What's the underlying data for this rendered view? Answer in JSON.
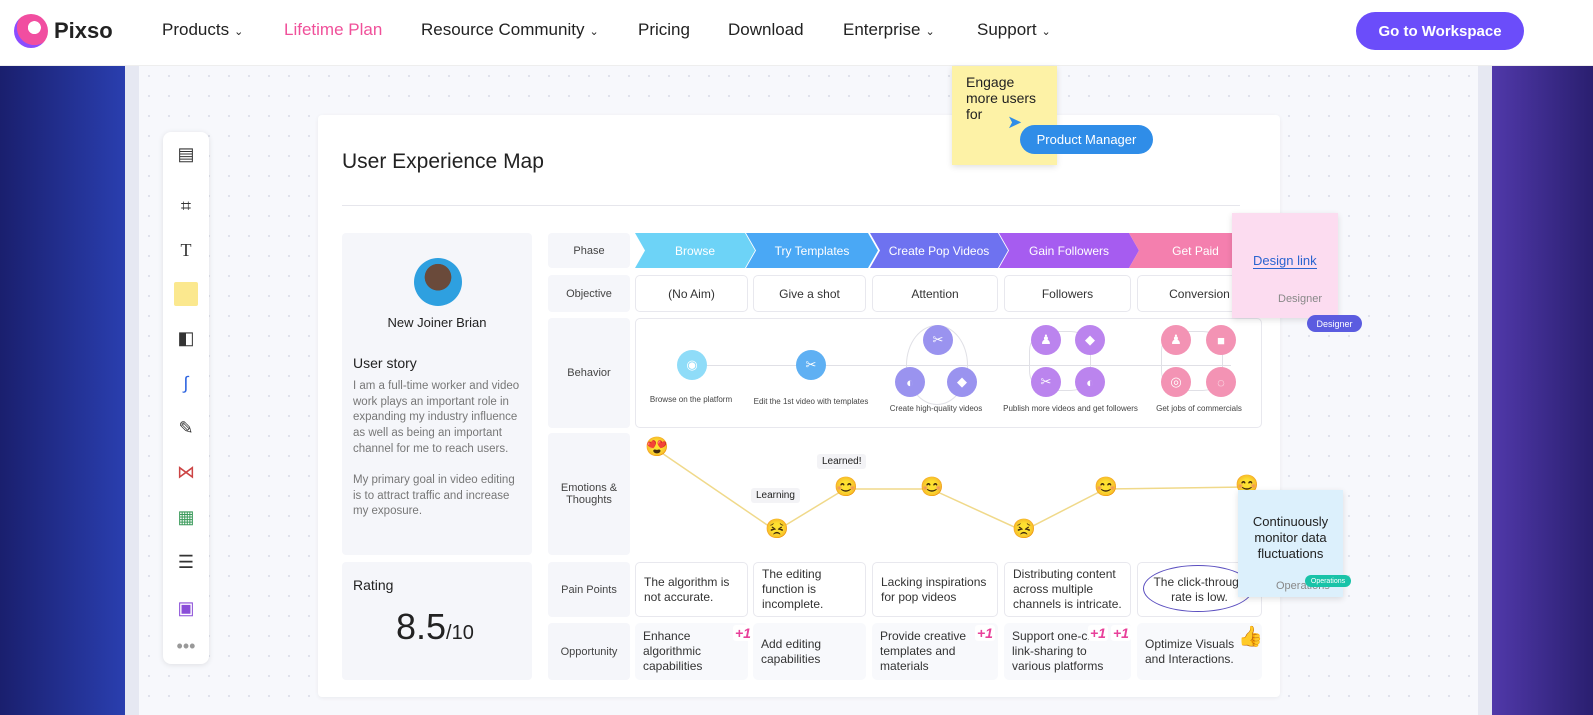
{
  "nav": {
    "brand": "Pixso",
    "items": [
      {
        "label": "Products",
        "dropdown": true
      },
      {
        "label": "Lifetime Plan",
        "highlight": "#f0509a"
      },
      {
        "label": "Resource Community",
        "dropdown": true
      },
      {
        "label": "Pricing"
      },
      {
        "label": "Download"
      },
      {
        "label": "Enterprise",
        "dropdown": true
      },
      {
        "label": "Support",
        "dropdown": true
      }
    ],
    "cta": "Go to Workspace",
    "cta_color": "#6b4dfa"
  },
  "toolbar": [
    "template-icon",
    "frame-icon",
    "text-icon",
    "sticky-note-icon",
    "shapes-icon",
    "connector-icon",
    "pen-icon",
    "mindmap-icon",
    "table-icon",
    "text-block-icon",
    "component-icon",
    "more-icon"
  ],
  "board": {
    "title": "User Experience Map",
    "persona": {
      "name": "New Joiner Brian",
      "story_label": "User story",
      "story_p1": "I am a full-time worker and video work plays an important role in expanding my industry influence as well as being an important channel for me to reach users.",
      "story_p2": "My primary goal in video editing is to attract traffic and increase my exposure.",
      "rating_label": "Rating",
      "rating": "8.5",
      "rating_max": "/10"
    },
    "row_labels": {
      "phase": "Phase",
      "objective": "Objective",
      "behavior": "Behavior",
      "emotions": "Emotions & Thoughts",
      "pain": "Pain Points",
      "opportunity": "Opportunity"
    },
    "phases": [
      {
        "label": "Browse",
        "color": "#6dd3f7"
      },
      {
        "label": "Try Templates",
        "color": "#4aa8f5"
      },
      {
        "label": "Create Pop Videos",
        "color": "#6e72f0"
      },
      {
        "label": "Gain Followers",
        "color": "#a65cf0"
      },
      {
        "label": "Get Paid",
        "color": "#f47fae"
      }
    ],
    "objectives": [
      "(No Aim)",
      "Give a shot",
      "Attention",
      "Followers",
      "Conversion"
    ],
    "behaviors": [
      "Browse on the platform",
      "Edit the 1st video with templates",
      "Create high-quality videos",
      "Publish more videos and get followers",
      "Get jobs of commercials"
    ],
    "emotion_labels": [
      "Learning",
      "Learned!"
    ],
    "pain_points": [
      "The algorithm is not accurate.",
      "The editing function is incomplete.",
      "Lacking inspirations for pop videos",
      "Distributing content across multiple channels is intricate.",
      "The click-through rate is low."
    ],
    "opportunities": [
      "Enhance algorithmic capabilities",
      "Add editing capabilities",
      "Provide creative templates and materials",
      "Support one-click link-sharing to various platforms",
      "Optimize Visuals and Interactions."
    ],
    "plus_one": "+1"
  },
  "notes": {
    "yellow": "Engage more users for",
    "pm_tag": "Product Manager",
    "pink_link": "Design link",
    "pink_author": "Designer",
    "designer_tag": "Designer",
    "blue": "Continuously monitor data fluctuations",
    "blue_author": "Operations",
    "ops_tag": "Operations"
  }
}
